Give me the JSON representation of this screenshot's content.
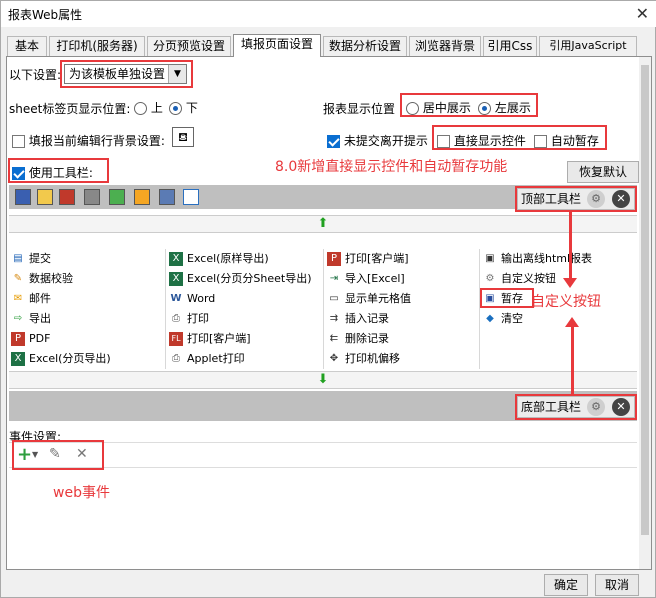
{
  "window": {
    "title": "报表Web属性",
    "close_glyph": "✕"
  },
  "tabs": [
    "基本",
    "打印机(服务器)",
    "分页预览设置",
    "填报页面设置",
    "数据分析设置",
    "浏览器背景",
    "引用Css",
    "引用JavaScript"
  ],
  "settings": {
    "below_label": "以下设置:",
    "below_select": "为该模板单独设置",
    "sheet_label": "sheet标签页显示位置:",
    "sheet_top": "上",
    "sheet_bottom": "下",
    "report_pos_label": "报表显示位置",
    "center_label": "居中展示",
    "left_label": "左展示",
    "fill_bg_label": "填报当前编辑行背景设置:",
    "unsubmitted_label": "未提交离开提示",
    "direct_display_label": "直接显示控件",
    "auto_save_label": "自动暂存",
    "use_toolbar_label": "使用工具栏:",
    "restore_default": "恢复默认"
  },
  "toolbar": {
    "top_label": "顶部工具栏",
    "bottom_label": "底部工具栏",
    "up_arrow": "⬆",
    "down_arrow": "⬇"
  },
  "grid_items": [
    [
      "提交",
      "Excel(原样导出)",
      "打印[客户端]",
      "输出离线html报表"
    ],
    [
      "数据校验",
      "Excel(分页分Sheet导出)",
      "导入[Excel]",
      "自定义按钮"
    ],
    [
      "邮件",
      "Word",
      "显示单元格值",
      "暂存"
    ],
    [
      "导出",
      "打印",
      "插入记录",
      "清空"
    ],
    [
      "PDF",
      "打印[客户端]",
      "删除记录",
      ""
    ],
    [
      "Excel(分页导出)",
      "Applet打印",
      "打印机偏移",
      ""
    ]
  ],
  "events": {
    "label": "事件设置:",
    "add": "+",
    "edit": "✎",
    "delete": "✕"
  },
  "annotations": {
    "new_feature": "8.0新增直接显示控件和自动暂存功能",
    "custom_button": "自定义按钮",
    "web_event": "web事件"
  },
  "footer": {
    "ok": "确定",
    "cancel": "取消"
  },
  "colors": {
    "annotation": "#e8393c",
    "accent": "#0a6ed1"
  }
}
